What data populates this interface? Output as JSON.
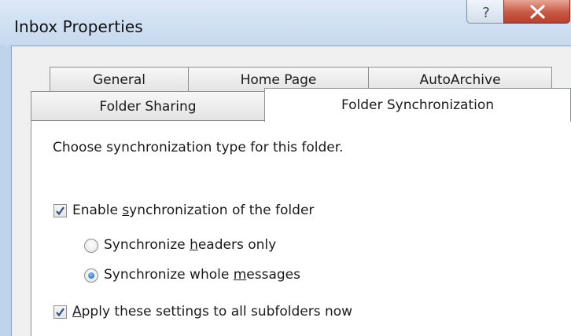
{
  "window": {
    "title": "Inbox Properties",
    "help_icon": "question-mark",
    "close_icon": "x"
  },
  "tabs": {
    "row_back": [
      {
        "label": "General"
      },
      {
        "label": "Home Page"
      },
      {
        "label": "AutoArchive"
      }
    ],
    "row_front": [
      {
        "label": "Folder Sharing"
      },
      {
        "label": "Folder Synchronization",
        "active": true
      }
    ]
  },
  "panel": {
    "instruction": "Choose synchronization type for this folder.",
    "enable_sync": {
      "checked": true,
      "label_pre": "Enable ",
      "label_mnemonic": "s",
      "label_post": "ynchronization of the folder"
    },
    "headers_only": {
      "selected": false,
      "label_pre": "Synchronize ",
      "label_mnemonic": "h",
      "label_post": "eaders only"
    },
    "whole_messages": {
      "selected": true,
      "label_pre": "Synchronize whole ",
      "label_mnemonic": "m",
      "label_post": "essages"
    },
    "apply_subfolders": {
      "checked": true,
      "label_pre": "",
      "label_mnemonic": "A",
      "label_post": "pply these settings to all subfolders now"
    }
  },
  "colors": {
    "frame": "#bfd3ea",
    "close_button": "#c75944",
    "checkmark": "#2a4f8a",
    "radio_dot": "#1b5fb0"
  }
}
